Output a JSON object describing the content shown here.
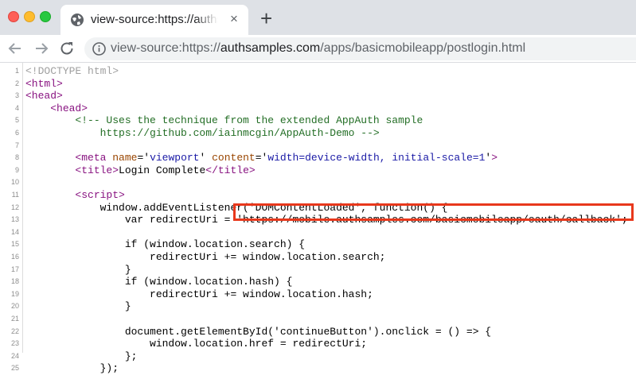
{
  "window": {
    "tab_title": "view-source:https://authsamples",
    "tab_close": "×",
    "new_tab": "+"
  },
  "toolbar": {
    "url_prefix": "view-source:https://",
    "url_host": "authsamples.com",
    "url_path": "/apps/basicmobileapp/postlogin.html"
  },
  "source": {
    "lines": [
      {
        "n": "1",
        "text": "<!DOCTYPE html>"
      },
      {
        "n": "2",
        "text": "<html>"
      },
      {
        "n": "3",
        "text": "<head>"
      },
      {
        "n": "4",
        "text": "    <head>"
      },
      {
        "n": "5",
        "text": "        <!-- Uses the technique from the extended AppAuth sample"
      },
      {
        "n": "6",
        "text": "            https://github.com/iainmcgin/AppAuth-Demo -->"
      },
      {
        "n": "7",
        "text": ""
      },
      {
        "n": "8",
        "text": "        <meta name='viewport' content='width=device-width, initial-scale=1'>"
      },
      {
        "n": "9",
        "text": "        <title>Login Complete</title>"
      },
      {
        "n": "10",
        "text": ""
      },
      {
        "n": "11",
        "text": "        <script>"
      },
      {
        "n": "12",
        "text": "            window.addEventListener('DOMContentLoaded', function() {"
      },
      {
        "n": "13",
        "text": "                var redirectUri = 'https://mobile.authsamples.com/basicmobileapp/oauth/callback';"
      },
      {
        "n": "14",
        "text": ""
      },
      {
        "n": "15",
        "text": "                if (window.location.search) {"
      },
      {
        "n": "16",
        "text": "                    redirectUri += window.location.search;"
      },
      {
        "n": "17",
        "text": "                }"
      },
      {
        "n": "18",
        "text": "                if (window.location.hash) {"
      },
      {
        "n": "19",
        "text": "                    redirectUri += window.location.hash;"
      },
      {
        "n": "20",
        "text": "                }"
      },
      {
        "n": "21",
        "text": ""
      },
      {
        "n": "22",
        "text": "                document.getElementById('continueButton').onclick = () => {"
      },
      {
        "n": "23",
        "text": "                    window.location.href = redirectUri;"
      },
      {
        "n": "24",
        "text": "                };"
      },
      {
        "n": "25",
        "text": "            });"
      }
    ]
  },
  "colors": {
    "highlight_box": "#e8381c",
    "tag": "#881280",
    "attribute": "#994500",
    "attribute_value": "#1a1aa6",
    "comment": "#236e25",
    "doctype": "#a0a0a0"
  },
  "icons": {
    "tab": "globe-icon",
    "back": "arrow-left-icon",
    "forward": "arrow-right-icon",
    "reload": "reload-icon",
    "site_info": "info-icon"
  }
}
